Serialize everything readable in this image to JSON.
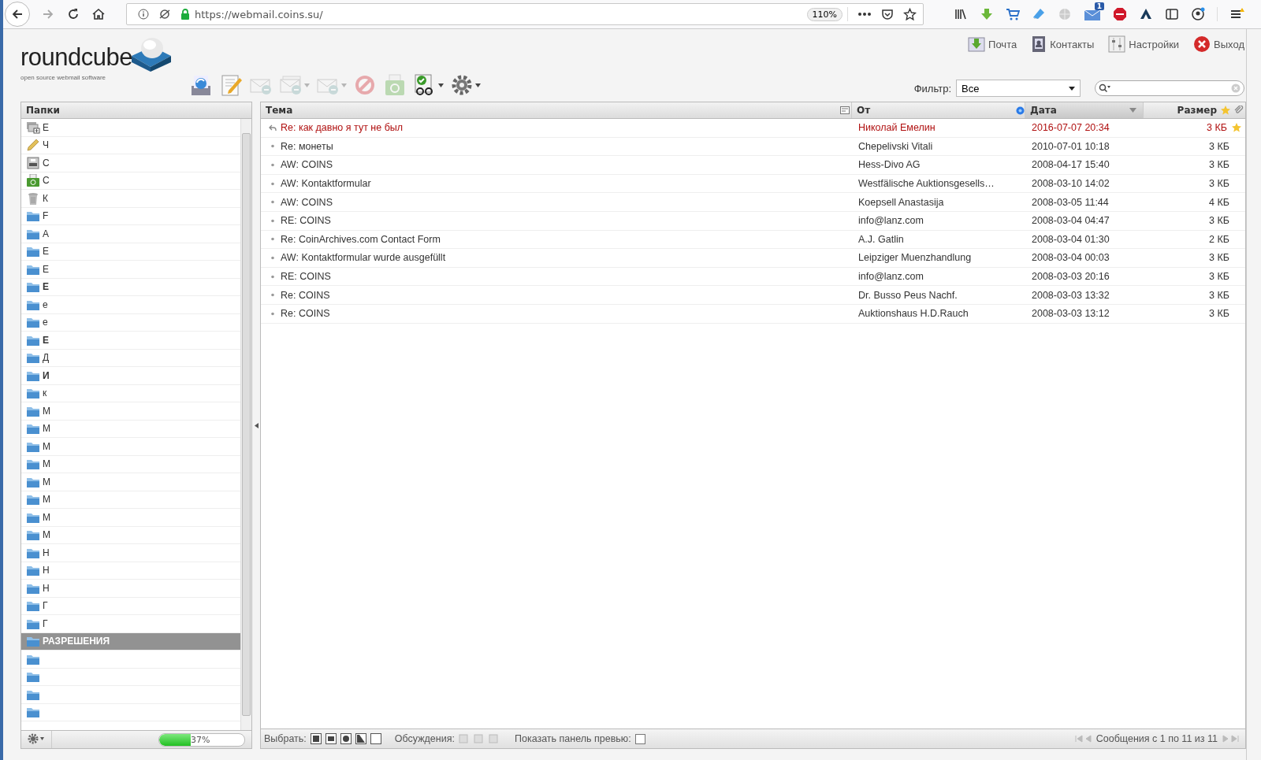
{
  "browser": {
    "url": "https://webmail.coins.su/",
    "zoom": "110%",
    "mail_badge": "1"
  },
  "app": {
    "logo": "roundcube",
    "tagline": "open source webmail software",
    "nav": [
      {
        "label": "Почта",
        "kind": "mail"
      },
      {
        "label": "Контакты",
        "kind": "contacts"
      },
      {
        "label": "Настройки",
        "kind": "settings"
      },
      {
        "label": "Выход",
        "kind": "logout"
      }
    ],
    "toolbar": [
      {
        "kind": "refresh",
        "disabled": false,
        "dropdown": false
      },
      {
        "kind": "compose",
        "disabled": false,
        "dropdown": false
      },
      {
        "kind": "reply",
        "disabled": true,
        "dropdown": false
      },
      {
        "kind": "reply-all",
        "disabled": true,
        "dropdown": true
      },
      {
        "kind": "forward",
        "disabled": true,
        "dropdown": true
      },
      {
        "kind": "delete",
        "disabled": true,
        "dropdown": false
      },
      {
        "kind": "archive",
        "disabled": true,
        "dropdown": false
      },
      {
        "kind": "mark",
        "disabled": false,
        "dropdown": true
      },
      {
        "kind": "more",
        "disabled": false,
        "dropdown": true
      }
    ],
    "filter": {
      "label": "Фильтр:",
      "value": "Все"
    }
  },
  "folders": {
    "title": "Папки",
    "quota": {
      "level": 0.37,
      "text": "37%"
    },
    "items": [
      {
        "label": "Е",
        "kind": "inbox",
        "bold": false,
        "selected": false
      },
      {
        "label": "Ч",
        "kind": "drafts",
        "bold": false,
        "selected": false
      },
      {
        "label": "С",
        "kind": "sent",
        "bold": false,
        "selected": false
      },
      {
        "label": "С",
        "kind": "junk",
        "bold": false,
        "selected": false
      },
      {
        "label": "К",
        "kind": "trash",
        "bold": false,
        "selected": false
      },
      {
        "label": "F",
        "kind": "folder",
        "bold": false,
        "selected": false
      },
      {
        "label": "A",
        "kind": "folder",
        "bold": false,
        "selected": false
      },
      {
        "label": "E",
        "kind": "folder",
        "bold": false,
        "selected": false
      },
      {
        "label": "E",
        "kind": "folder",
        "bold": false,
        "selected": false
      },
      {
        "label": "E",
        "kind": "folder",
        "bold": true,
        "selected": false
      },
      {
        "label": "е",
        "kind": "folder",
        "bold": false,
        "selected": false
      },
      {
        "label": "е",
        "kind": "folder",
        "bold": false,
        "selected": false
      },
      {
        "label": "E",
        "kind": "folder",
        "bold": true,
        "selected": false
      },
      {
        "label": "Д",
        "kind": "folder",
        "bold": false,
        "selected": false
      },
      {
        "label": "И",
        "kind": "folder",
        "bold": true,
        "selected": false
      },
      {
        "label": "к",
        "kind": "folder",
        "bold": false,
        "selected": false
      },
      {
        "label": "М",
        "kind": "folder",
        "bold": false,
        "selected": false
      },
      {
        "label": "М",
        "kind": "folder",
        "bold": false,
        "selected": false
      },
      {
        "label": "М",
        "kind": "folder",
        "bold": false,
        "selected": false
      },
      {
        "label": "М",
        "kind": "folder",
        "bold": false,
        "selected": false
      },
      {
        "label": "М",
        "kind": "folder",
        "bold": false,
        "selected": false
      },
      {
        "label": "М",
        "kind": "folder",
        "bold": false,
        "selected": false
      },
      {
        "label": "М",
        "kind": "folder",
        "bold": false,
        "selected": false
      },
      {
        "label": "М",
        "kind": "folder",
        "bold": false,
        "selected": false
      },
      {
        "label": "Н",
        "kind": "folder",
        "bold": false,
        "selected": false
      },
      {
        "label": "Н",
        "kind": "folder",
        "bold": false,
        "selected": false
      },
      {
        "label": "Н",
        "kind": "folder",
        "bold": false,
        "selected": false
      },
      {
        "label": "Г",
        "kind": "folder",
        "bold": false,
        "selected": false
      },
      {
        "label": "Г",
        "kind": "folder",
        "bold": false,
        "selected": false
      },
      {
        "label": "РАЗРЕШЕНИЯ",
        "kind": "folder",
        "bold": true,
        "selected": true
      },
      {
        "kind": "folder",
        "selected": false
      },
      {
        "kind": "folder",
        "selected": false
      },
      {
        "kind": "folder",
        "selected": false
      },
      {
        "kind": "folder",
        "selected": false
      }
    ]
  },
  "messages": {
    "columns": [
      {
        "label": "Тема",
        "sorted": false
      },
      {
        "label": "От",
        "sorted": false
      },
      {
        "label": "Дата",
        "sorted": true
      },
      {
        "label": "Размер",
        "sorted": false
      }
    ],
    "rows": [
      {
        "subject": "Re: как давно я тут не был",
        "from": "Николай Емелин",
        "date": "2016-07-07 20:34",
        "size": "3 КБ",
        "flagged": true,
        "replied": true
      },
      {
        "subject": "Re: монеты",
        "from": "Chepelivski Vitali",
        "date": "2010-07-01 10:18",
        "size": "3 КБ",
        "flagged": false,
        "replied": false
      },
      {
        "subject": "AW: COINS",
        "from": "Hess-Divo AG",
        "date": "2008-04-17 15:40",
        "size": "3 КБ",
        "flagged": false,
        "replied": false
      },
      {
        "subject": "AW: Kontaktformular",
        "from": "Westfälische Auktionsgesells…",
        "date": "2008-03-10 14:02",
        "size": "3 КБ",
        "flagged": false,
        "replied": false
      },
      {
        "subject": "AW: COINS",
        "from": "Koepsell Anastasija",
        "date": "2008-03-05 11:44",
        "size": "4 КБ",
        "flagged": false,
        "replied": false
      },
      {
        "subject": "RE: COINS",
        "from": "info@lanz.com",
        "date": "2008-03-04 04:47",
        "size": "3 КБ",
        "flagged": false,
        "replied": false
      },
      {
        "subject": "Re: CoinArchives.com Contact Form",
        "from": "A.J. Gatlin",
        "date": "2008-03-04 01:30",
        "size": "2 КБ",
        "flagged": false,
        "replied": false
      },
      {
        "subject": "AW: Kontaktformular wurde ausgefüllt",
        "from": "Leipziger Muenzhandlung",
        "date": "2008-03-04 00:03",
        "size": "3 КБ",
        "flagged": false,
        "replied": false
      },
      {
        "subject": "RE: COINS",
        "from": "info@lanz.com",
        "date": "2008-03-03 20:16",
        "size": "3 КБ",
        "flagged": false,
        "replied": false
      },
      {
        "subject": "Re: COINS",
        "from": "Dr. Busso Peus Nachf.",
        "date": "2008-03-03 13:32",
        "size": "3 КБ",
        "flagged": false,
        "replied": false
      },
      {
        "subject": "Re: COINS",
        "from": "Auktionshaus H.D.Rauch",
        "date": "2008-03-03 13:12",
        "size": "3 КБ",
        "flagged": false,
        "replied": false
      }
    ],
    "footer": {
      "select_label": "Выбрать:",
      "threads_label": "Обсуждения:",
      "preview_label": "Показать панель превью:",
      "preview_checked": false,
      "count": "Сообщения с 1 по 11 из 11"
    }
  }
}
